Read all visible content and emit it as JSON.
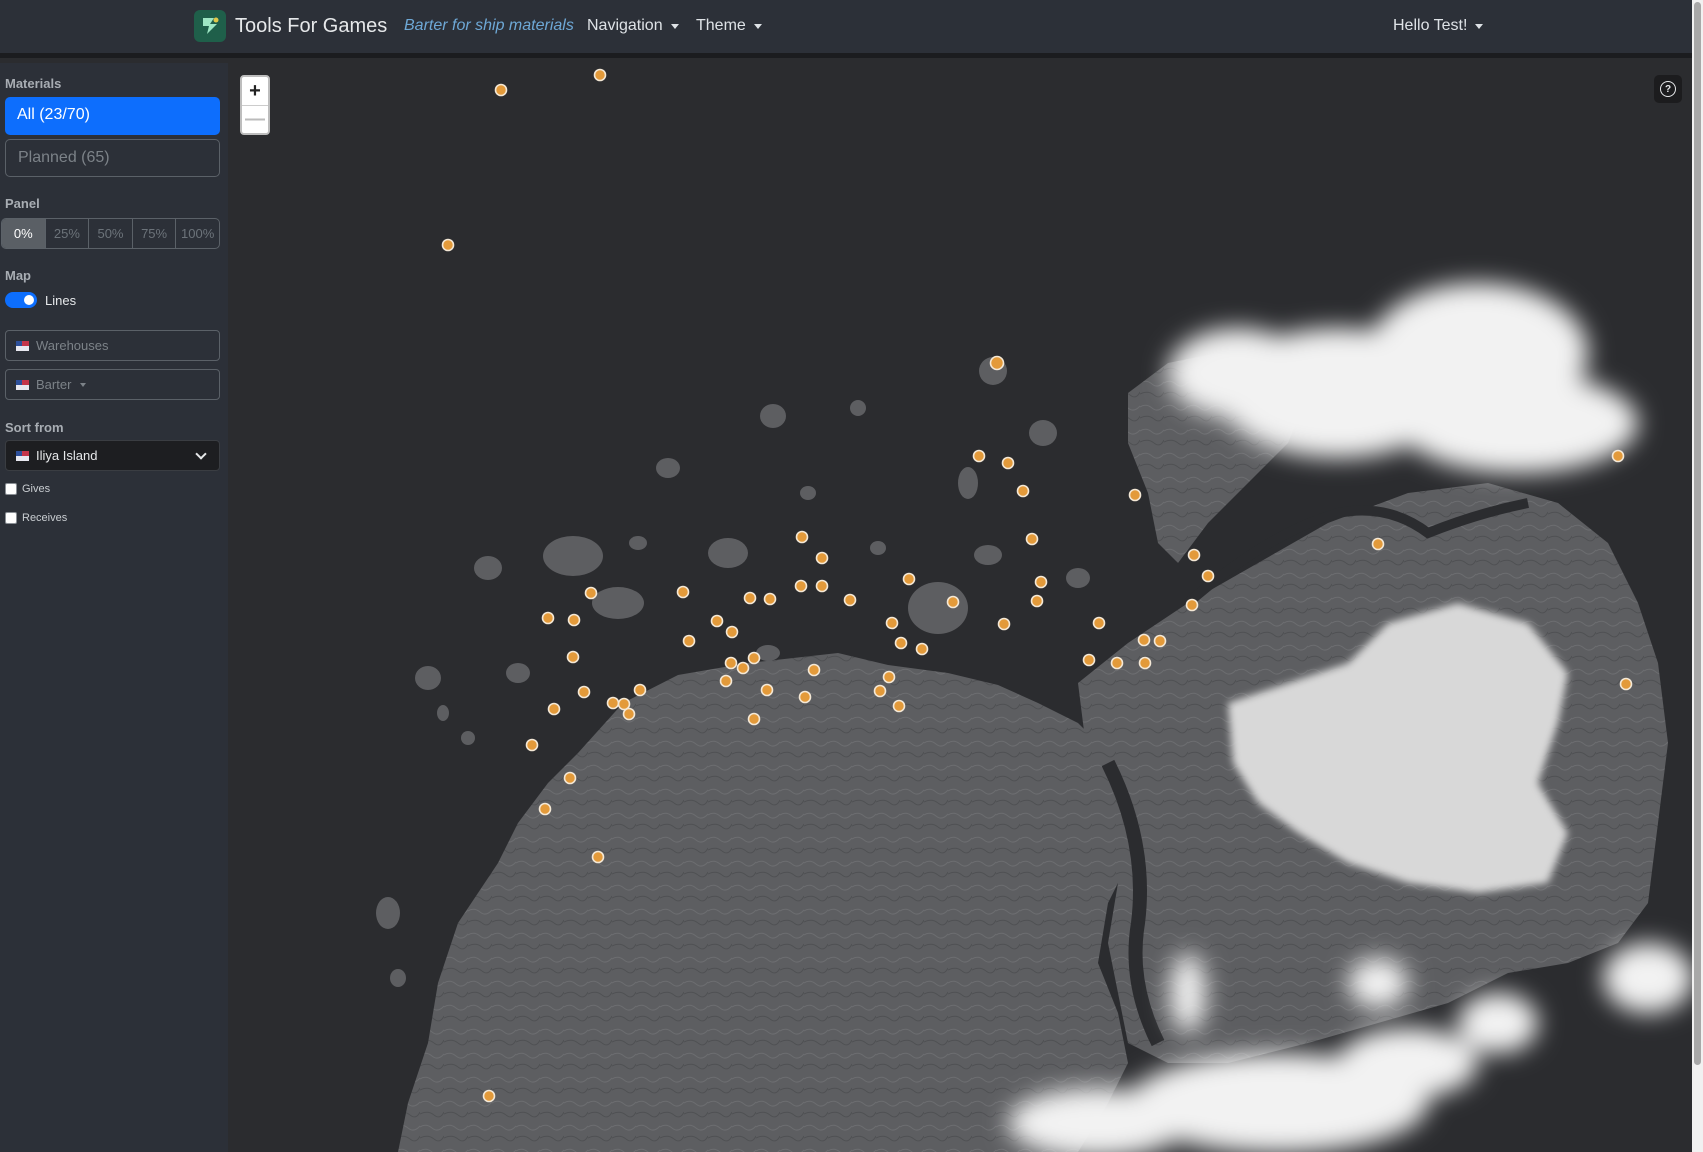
{
  "navbar": {
    "brand": "Tools For Games",
    "active_page": "Barter for ship materials",
    "navigation_label": "Navigation",
    "theme_label": "Theme",
    "user_label": "Hello Test!"
  },
  "sidebar": {
    "materials": {
      "heading": "Materials",
      "all_label": "All (23/70)",
      "planned_label": "Planned (65)"
    },
    "panel": {
      "heading": "Panel",
      "options": [
        "0%",
        "25%",
        "50%",
        "75%",
        "100%"
      ],
      "selected": "0%"
    },
    "map": {
      "heading": "Map",
      "lines_label": "Lines",
      "lines_on": true,
      "warehouses_placeholder": "Warehouses",
      "barter_placeholder": "Barter"
    },
    "sort": {
      "heading": "Sort from",
      "selected": "Iliya Island",
      "gives_label": "Gives",
      "receives_label": "Receives",
      "gives_checked": false,
      "receives_checked": false
    }
  },
  "map_controls": {
    "zoom_in": "+",
    "zoom_out": "—",
    "help": "?"
  },
  "map_style": {
    "marker_color": "#e39a3a",
    "marker_stroke": "#f4e8d6",
    "sea_color": "#2b2c2f",
    "land_color": "#5d5e61",
    "snow_color": "#d8d8d8",
    "cloud_color": "#f2f2f2"
  },
  "colors": {
    "accent": "#0d6efd",
    "navbar_bg": "#2c3038",
    "link_italic": "#6ea8d6"
  }
}
